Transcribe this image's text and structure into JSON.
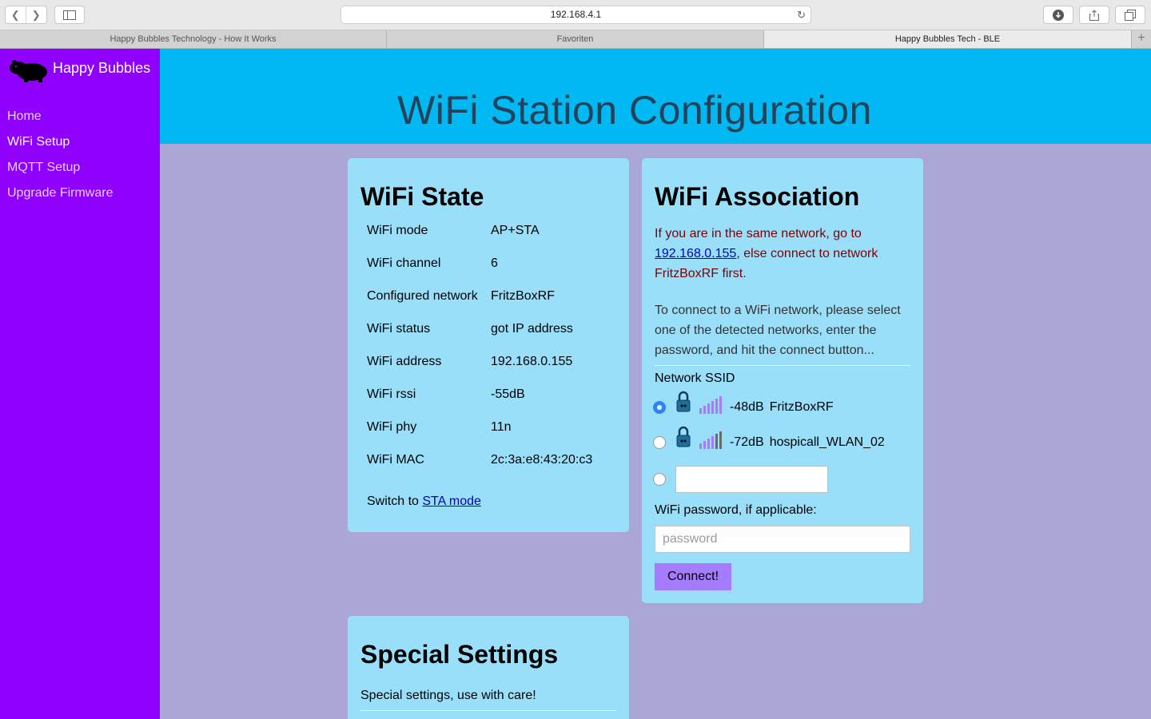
{
  "browser": {
    "url": "192.168.4.1",
    "tabs": [
      {
        "label": "Happy Bubbles Technology - How It Works",
        "active": false
      },
      {
        "label": "Favoriten",
        "active": false
      },
      {
        "label": "Happy Bubbles Tech - BLE",
        "active": true
      }
    ]
  },
  "sidebar": {
    "brand": "Happy Bubbles",
    "items": [
      {
        "label": "Home"
      },
      {
        "label": "WiFi Setup"
      },
      {
        "label": "MQTT Setup"
      },
      {
        "label": "Upgrade Firmware"
      }
    ],
    "active_item": "WiFi Setup"
  },
  "header": {
    "title": "WiFi Station Configuration"
  },
  "wifi_state": {
    "title": "WiFi State",
    "rows": [
      {
        "key": "WiFi mode",
        "value": "AP+STA"
      },
      {
        "key": "WiFi channel",
        "value": "6"
      },
      {
        "key": "Configured network",
        "value": "FritzBoxRF"
      },
      {
        "key": "WiFi status",
        "value": "got IP address"
      },
      {
        "key": "WiFi address",
        "value": "192.168.0.155"
      },
      {
        "key": "WiFi rssi",
        "value": "-55dB"
      },
      {
        "key": "WiFi phy",
        "value": "11n"
      },
      {
        "key": "WiFi MAC",
        "value": "2c:3a:e8:43:20:c3"
      }
    ],
    "switch_prefix": "Switch to",
    "switch_link": "STA mode"
  },
  "wifi_assoc": {
    "title": "WiFi Association",
    "warning_prefix": "If you are in the same network, go to",
    "warning_link": "192.168.0.155",
    "warning_suffix": ", else connect to network FritzBoxRF first.",
    "info": "To connect to a WiFi network, please select one of the detected networks, enter the password, and hit the connect button...",
    "ssid_label": "Network SSID",
    "networks": [
      {
        "rssi": "-48dB",
        "ssid": "FritzBoxRF",
        "selected": true,
        "locked": true
      },
      {
        "rssi": "-72dB",
        "ssid": "hospicall_WLAN_02",
        "selected": false,
        "locked": true
      }
    ],
    "manual_ssid_value": "",
    "password_label": "WiFi password, if applicable:",
    "password_placeholder": "password",
    "connect_label": "Connect!"
  },
  "special": {
    "title": "Special Settings",
    "desc": "Special settings, use with care!"
  },
  "colors": {
    "sidebar": "#8f00ff",
    "header": "#00b9f2",
    "card": "#99dffa",
    "page_bg": "#aaa7d6",
    "button": "#a57bff",
    "warning_text": "#800000"
  }
}
